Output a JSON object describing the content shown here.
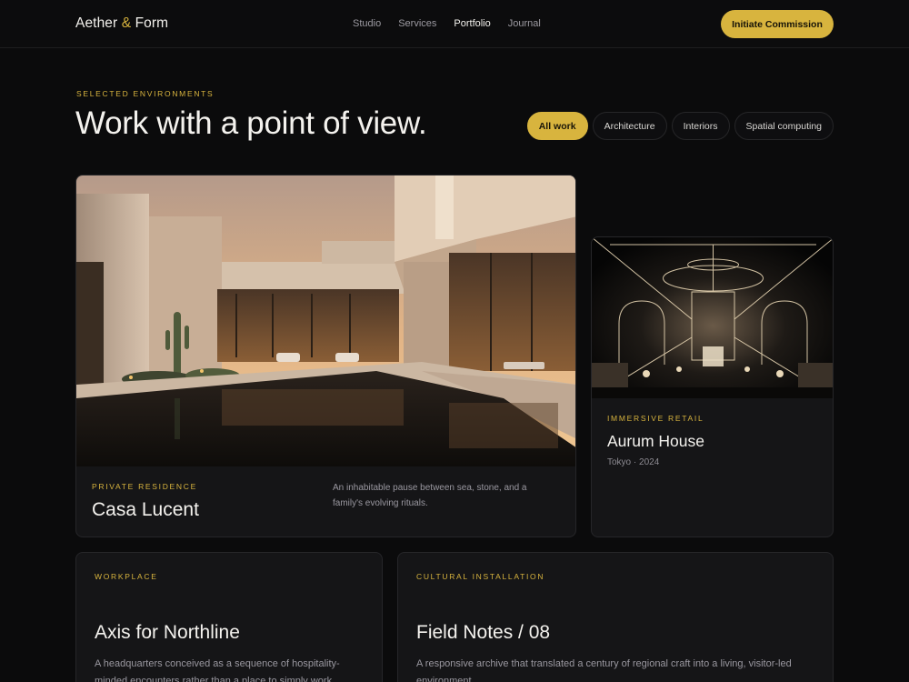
{
  "brand": {
    "name_left": "Aether",
    "amp": "&",
    "name_right": "Form"
  },
  "nav": {
    "items": [
      {
        "label": "Studio"
      },
      {
        "label": "Services"
      },
      {
        "label": "Portfolio"
      },
      {
        "label": "Journal"
      }
    ],
    "active": "Portfolio"
  },
  "header": {
    "cta_label": "Initiate Commission"
  },
  "intro": {
    "eyebrow": "Selected Environments",
    "title": "Work with a point of view."
  },
  "filters": [
    {
      "label": "All work",
      "active": true
    },
    {
      "label": "Architecture"
    },
    {
      "label": "Interiors"
    },
    {
      "label": "Spatial computing"
    }
  ],
  "projects": {
    "casa": {
      "category": "Private Residence",
      "title": "Casa Lucent",
      "description": "An inhabitable pause between sea, stone, and a family's evolving rituals."
    },
    "aurum": {
      "category": "Immersive Retail",
      "title": "Aurum House",
      "meta": "Tokyo · 2024"
    },
    "axis": {
      "category": "Workplace",
      "title": "Axis for Northline",
      "description": "A headquarters conceived as a sequence of hospitality-minded encounters rather than a place to simply work."
    },
    "field": {
      "category": "Cultural Installation",
      "title": "Field Notes / 08",
      "description": "A responsive archive that translated a century of regional craft into a living, visitor-led environment."
    }
  },
  "colors": {
    "accent": "#d8b43e",
    "background": "#0b0b0c",
    "card": "#151517"
  }
}
